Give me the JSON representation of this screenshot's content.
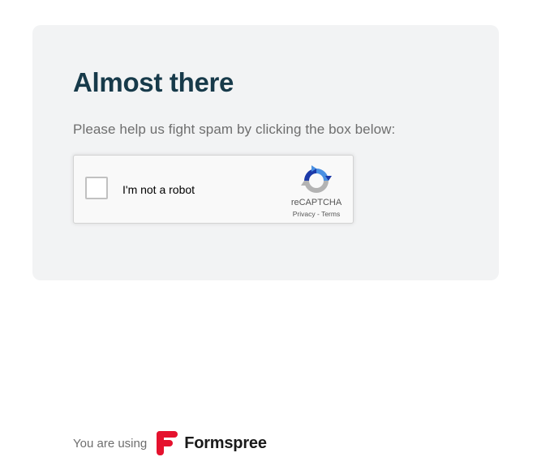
{
  "page": {
    "title": "Almost there",
    "instructions": "Please help us fight spam by clicking the box below:"
  },
  "recaptcha": {
    "checkbox_label": "I'm not a robot",
    "brand": "reCAPTCHA",
    "privacy_link": "Privacy",
    "separator": "-",
    "terms_link": "Terms",
    "checked": false
  },
  "footer": {
    "using_text": "You are using",
    "brand_name": "Formspree",
    "brand_color": "#e5122e"
  },
  "colors": {
    "title": "#173a4a",
    "card_background": "#f2f3f4",
    "text_muted": "#6e6e6e"
  }
}
